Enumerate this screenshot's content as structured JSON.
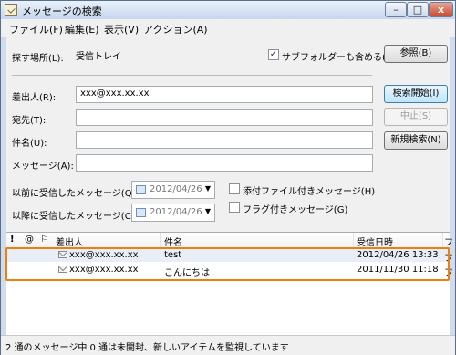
{
  "window": {
    "title": "メッセージの検索",
    "controls": {
      "minimize": "–",
      "maximize": "□",
      "close": "x"
    }
  },
  "menu": [
    "ファイル(F)",
    "編集(E)",
    "表示(V)",
    "アクション(A)"
  ],
  "search": {
    "location_label": "探す場所(L):",
    "location_value": "受信トレイ",
    "subfolders_label": "サブフォルダーも含める(D)",
    "subfolders_checked": true,
    "browse_button": "参照(B)",
    "from_label": "差出人(R):",
    "from_value": "xxx@xxx.xx.xx",
    "to_label": "宛先(T):",
    "to_value": "",
    "subject_label": "件名(U):",
    "subject_value": "",
    "message_label": "メッセージ(A):",
    "message_value": "",
    "received_before_label": "以前に受信したメッセージ(Q):",
    "received_before_value": "2012/04/26",
    "received_after_label": "以降に受信したメッセージ(C):",
    "received_after_value": "2012/04/26",
    "attachment_label": "添付ファイル付きメッセージ(H)",
    "attachment_checked": false,
    "flagged_label": "フラグ付きメッセージ(G)",
    "flagged_checked": false,
    "start_button": "検索開始(I)",
    "stop_button": "中止(S)",
    "new_search_button": "新規検索(N)"
  },
  "results": {
    "columns": {
      "importance": "!",
      "attachment": "@",
      "flag": "⚐",
      "from": "差出人",
      "subject": "件名",
      "received": "受信日時",
      "extra": "フ"
    },
    "rows": [
      {
        "from": "xxx@xxx.xx.xx",
        "subject": "test",
        "received": "2012/04/26 13:33",
        "extra": "フ"
      },
      {
        "from": "xxx@xxx.xx.xx",
        "subject": "こんにちは",
        "received": "2011/11/30 11:18",
        "extra": "フ"
      }
    ]
  },
  "status": "2 通のメッセージ中 0 通は未開封、新しいアイテムを監視しています",
  "colors": {
    "highlight": "#f07d10",
    "window_frame": "#cfdcec",
    "selected_row": "#e8eef6"
  }
}
